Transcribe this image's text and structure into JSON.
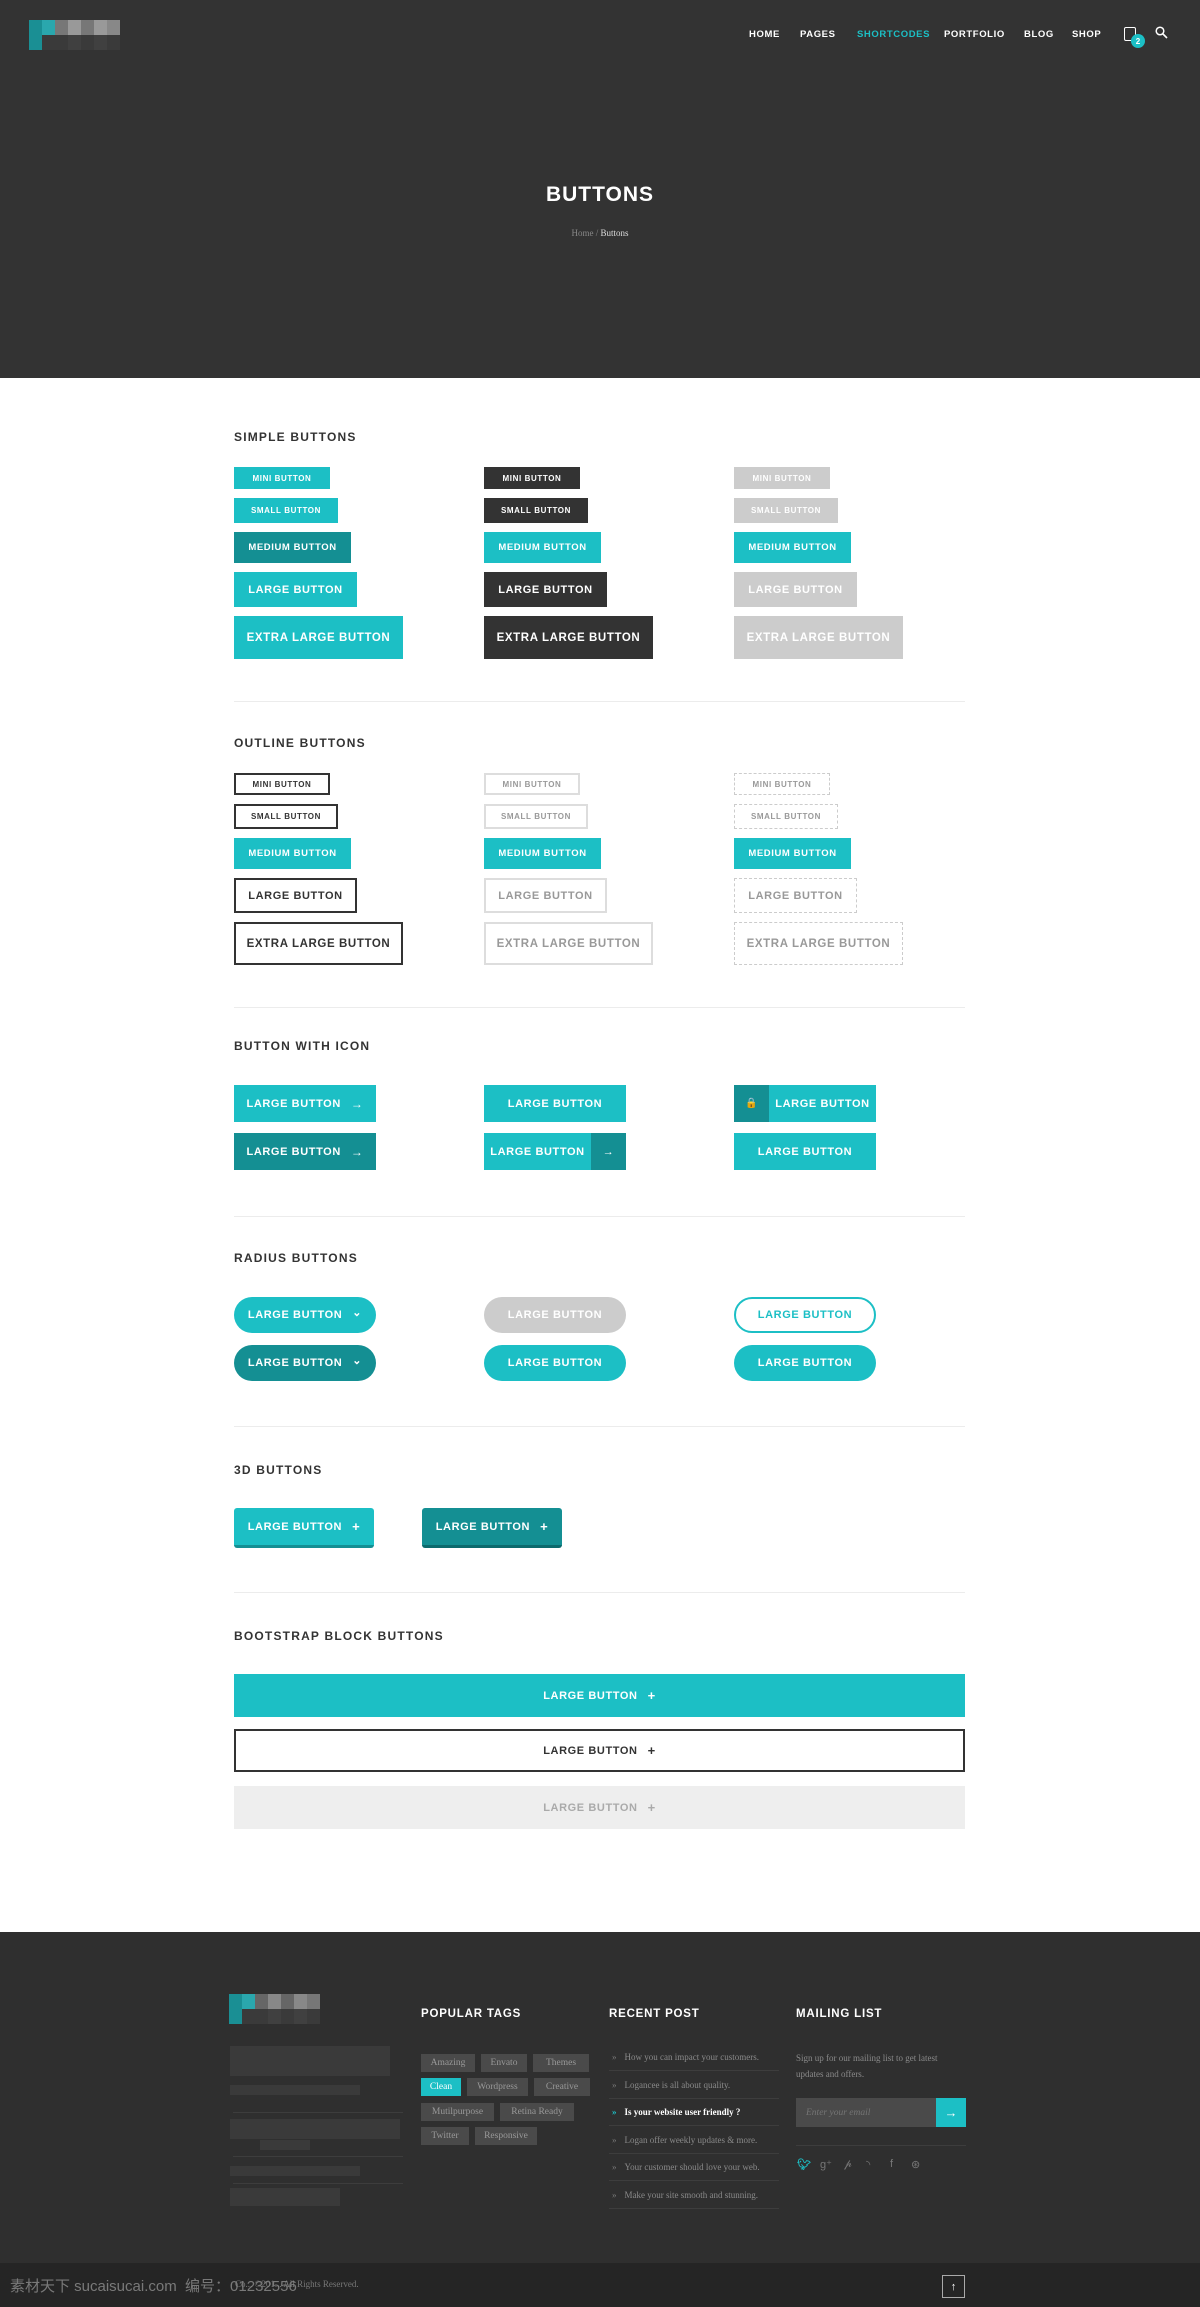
{
  "header": {
    "nav": [
      {
        "label": "HOME",
        "active": false
      },
      {
        "label": "PAGES",
        "active": false
      },
      {
        "label": "SHORTCODES",
        "active": true
      },
      {
        "label": "PORTFOLIO",
        "active": false
      },
      {
        "label": "BLOG",
        "active": false
      },
      {
        "label": "SHOP",
        "active": false
      }
    ],
    "cart_count": "2",
    "cart_icon": "shopping-bag-icon",
    "search_icon": "search-icon"
  },
  "hero": {
    "title": "BUTTONS",
    "breadcrumb": {
      "home": "Home",
      "separator": " / ",
      "current": "Buttons"
    }
  },
  "colors": {
    "accent": "#1cbfc5",
    "accent_dark": "#148f93",
    "dark": "#333333",
    "gray": "#cccccc"
  },
  "sections": {
    "simple": {
      "title": "SIMPLE BUTTONS",
      "columns": [
        [
          {
            "label": "MINI BUTTON",
            "size": "mini",
            "style": "teal"
          },
          {
            "label": "SMALL BUTTON",
            "size": "small",
            "style": "teal"
          },
          {
            "label": "MEDIUM BUTTON",
            "size": "medium",
            "style": "darkteal"
          },
          {
            "label": "LARGE BUTTON",
            "size": "large",
            "style": "teal"
          },
          {
            "label": "EXTRA LARGE BUTTON",
            "size": "xl",
            "style": "teal"
          }
        ],
        [
          {
            "label": "MINI BUTTON",
            "size": "mini",
            "style": "dark"
          },
          {
            "label": "SMALL BUTTON",
            "size": "small",
            "style": "dark"
          },
          {
            "label": "MEDIUM BUTTON",
            "size": "medium",
            "style": "teal"
          },
          {
            "label": "LARGE BUTTON",
            "size": "large",
            "style": "dark"
          },
          {
            "label": "EXTRA LARGE BUTTON",
            "size": "xl",
            "style": "dark"
          }
        ],
        [
          {
            "label": "MINI BUTTON",
            "size": "mini",
            "style": "gray"
          },
          {
            "label": "SMALL BUTTON",
            "size": "small",
            "style": "gray"
          },
          {
            "label": "MEDIUM BUTTON",
            "size": "medium",
            "style": "teal"
          },
          {
            "label": "LARGE BUTTON",
            "size": "large",
            "style": "gray"
          },
          {
            "label": "EXTRA LARGE BUTTON",
            "size": "xl",
            "style": "gray"
          }
        ]
      ]
    },
    "outline": {
      "title": "OUTLINE BUTTONS",
      "columns": [
        [
          {
            "label": "MINI BUTTON",
            "size": "mini",
            "style": "outline-dark"
          },
          {
            "label": "SMALL BUTTON",
            "size": "small",
            "style": "outline-dark"
          },
          {
            "label": "MEDIUM BUTTON",
            "size": "medium",
            "style": "teal"
          },
          {
            "label": "LARGE BUTTON",
            "size": "large",
            "style": "outline-dark"
          },
          {
            "label": "EXTRA LARGE BUTTON",
            "size": "xl",
            "style": "outline-dark"
          }
        ],
        [
          {
            "label": "MINI BUTTON",
            "size": "mini",
            "style": "outline-light"
          },
          {
            "label": "SMALL BUTTON",
            "size": "small",
            "style": "outline-light"
          },
          {
            "label": "MEDIUM BUTTON",
            "size": "medium",
            "style": "teal"
          },
          {
            "label": "LARGE BUTTON",
            "size": "large",
            "style": "outline-light"
          },
          {
            "label": "EXTRA LARGE BUTTON",
            "size": "xl",
            "style": "outline-light"
          }
        ],
        [
          {
            "label": "MINI BUTTON",
            "size": "mini",
            "style": "outline-dashed"
          },
          {
            "label": "SMALL BUTTON",
            "size": "small",
            "style": "outline-dashed"
          },
          {
            "label": "MEDIUM BUTTON",
            "size": "medium",
            "style": "teal"
          },
          {
            "label": "LARGE BUTTON",
            "size": "large",
            "style": "outline-dashed"
          },
          {
            "label": "EXTRA LARGE BUTTON",
            "size": "xl",
            "style": "outline-dashed"
          }
        ]
      ]
    },
    "icon": {
      "title": "BUTTON WITH ICON",
      "columns": [
        [
          {
            "label": "LARGE BUTTON",
            "style": "teal",
            "icon": "arrow-right-icon",
            "glyph": "→",
            "layout": "inline-right"
          },
          {
            "label": "LARGE BUTTON",
            "style": "darkteal",
            "icon": "arrow-right-icon",
            "glyph": "→",
            "layout": "inline-right"
          }
        ],
        [
          {
            "label": "LARGE BUTTON",
            "style": "teal",
            "layout": "plain"
          },
          {
            "label": "LARGE BUTTON",
            "style": "teal",
            "icon": "arrow-right-icon",
            "glyph": "→",
            "layout": "segment-right"
          }
        ],
        [
          {
            "label": "LARGE BUTTON",
            "style": "teal",
            "icon": "lock-icon",
            "glyph": "🔒",
            "layout": "segment-left"
          },
          {
            "label": "LARGE BUTTON",
            "style": "teal",
            "layout": "plain"
          }
        ]
      ]
    },
    "radius": {
      "title": "RADIUS BUTTONS",
      "columns": [
        [
          {
            "label": "LARGE BUTTON",
            "style": "teal",
            "icon": "chevron-down-icon",
            "glyph": "⌄"
          },
          {
            "label": "LARGE BUTTON",
            "style": "darkteal",
            "icon": "chevron-down-icon",
            "glyph": "⌄"
          }
        ],
        [
          {
            "label": "LARGE BUTTON",
            "style": "gray"
          },
          {
            "label": "LARGE BUTTON",
            "style": "teal"
          }
        ],
        [
          {
            "label": "LARGE BUTTON",
            "style": "outline"
          },
          {
            "label": "LARGE BUTTON",
            "style": "teal"
          }
        ]
      ]
    },
    "threed": {
      "title": "3D BUTTONS",
      "buttons": [
        {
          "label": "LARGE BUTTON",
          "style": "teal",
          "icon": "plus-icon",
          "glyph": "+"
        },
        {
          "label": "LARGE BUTTON",
          "style": "darkteal",
          "icon": "plus-icon",
          "glyph": "+"
        }
      ]
    },
    "block": {
      "title": "BOOTSTRAP BLOCK BUTTONS",
      "buttons": [
        {
          "label": "LARGE BUTTON",
          "style": "teal",
          "icon": "plus-icon",
          "glyph": "+"
        },
        {
          "label": "LARGE BUTTON",
          "style": "white",
          "icon": "plus-icon",
          "glyph": "+"
        },
        {
          "label": "LARGE BUTTON",
          "style": "light",
          "icon": "plus-icon",
          "glyph": "+"
        }
      ]
    }
  },
  "footer": {
    "tags_title": "POPULAR TAGS",
    "tags": [
      {
        "label": "Amazing",
        "active": false
      },
      {
        "label": "Envato",
        "active": false
      },
      {
        "label": "Themes",
        "active": false
      },
      {
        "label": "Clean",
        "active": true
      },
      {
        "label": "Wordpress",
        "active": false
      },
      {
        "label": "Creative",
        "active": false
      },
      {
        "label": "Mutilpurpose",
        "active": false
      },
      {
        "label": "Retina Ready",
        "active": false
      },
      {
        "label": "Twitter",
        "active": false
      },
      {
        "label": "Responsive",
        "active": false
      }
    ],
    "recent_title": "RECENT POST",
    "recent": [
      {
        "label": "How you can impact your customers.",
        "highlight": false
      },
      {
        "label": "Logancee is all about quality.",
        "highlight": false
      },
      {
        "label": "Is your website user friendly ?",
        "highlight": true
      },
      {
        "label": "Logan offer weekly updates & more.",
        "highlight": false
      },
      {
        "label": "Your customer should love your web.",
        "highlight": false
      },
      {
        "label": "Make your site smooth and stunning.",
        "highlight": false
      }
    ],
    "mailing_title": "MAILING LIST",
    "mailing_text": "Sign up for our mailing list to get latest updates and offers.",
    "email_placeholder": "Enter your email",
    "social": [
      "twitter-icon",
      "google-plus-icon",
      "pinterest-icon",
      "rss-icon",
      "facebook-icon",
      "dribbble-icon"
    ],
    "copyright": "Co... ©201... All Rights Reserved.",
    "watermark": "素材天下 sucaisucai.com  编号：01232556"
  }
}
